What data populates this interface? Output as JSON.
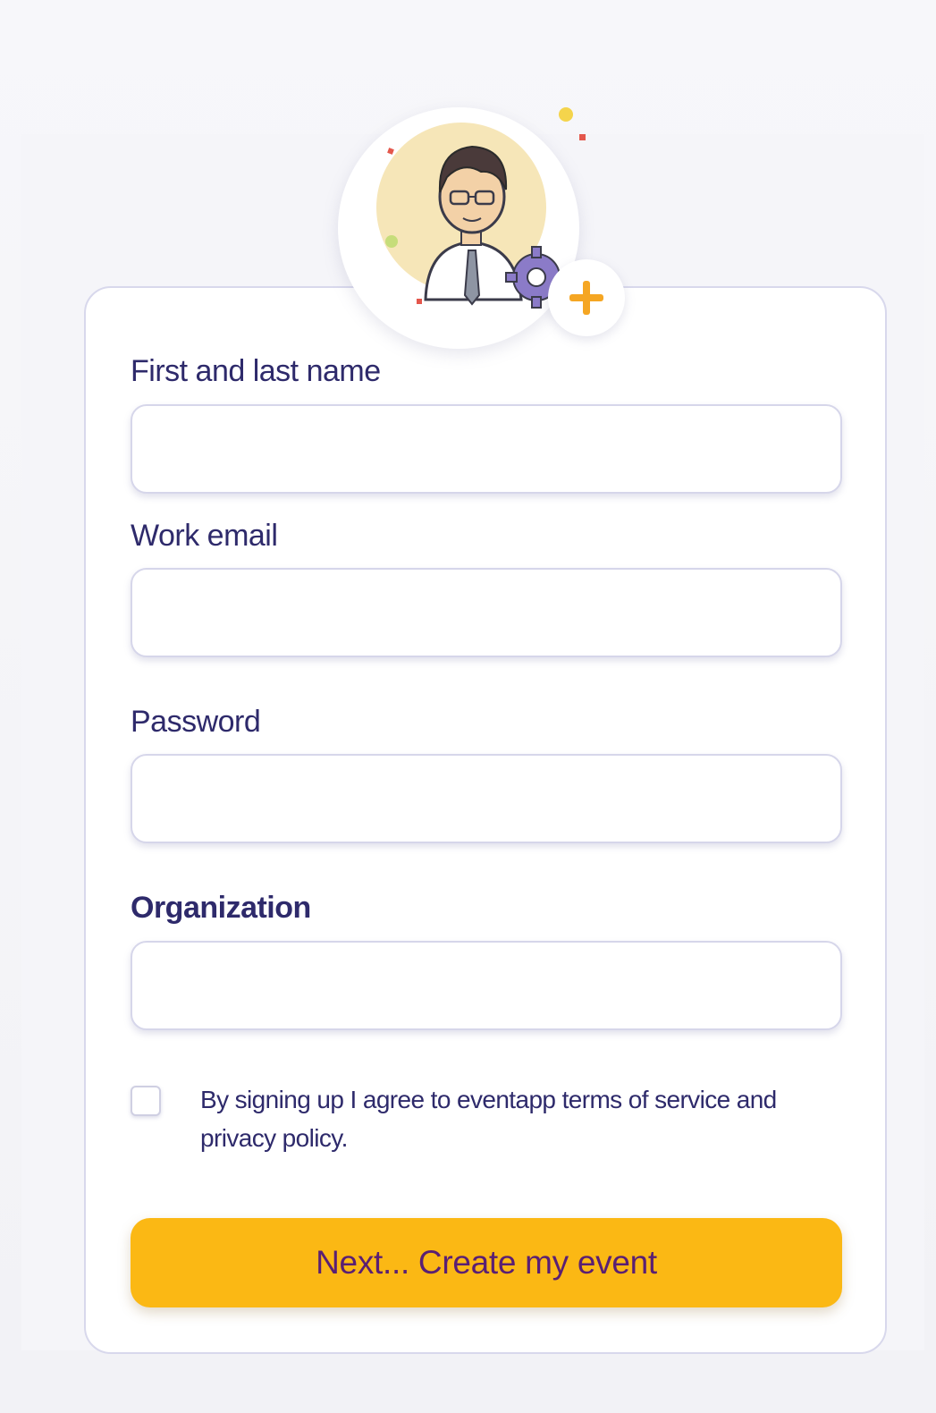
{
  "form": {
    "fields": [
      {
        "label": "First and last name",
        "value": "",
        "placeholder": ""
      },
      {
        "label": "Work email",
        "value": "",
        "placeholder": ""
      },
      {
        "label": "Password",
        "value": "",
        "placeholder": ""
      },
      {
        "label": "Organization",
        "value": "",
        "placeholder": ""
      }
    ],
    "terms": {
      "checked": false,
      "text": "By signing up I agree to eventapp terms of service and privacy policy."
    },
    "submit_label": "Next... Create my event"
  },
  "avatar": {
    "icon": "user-avatar-illustration",
    "badge_icon": "plus-icon",
    "badge_color": "#f5a623"
  },
  "colors": {
    "label_text": "#2e2a6b",
    "button_bg": "#fbb814",
    "button_text": "#5a1f73",
    "card_border": "#d8d8ec"
  }
}
